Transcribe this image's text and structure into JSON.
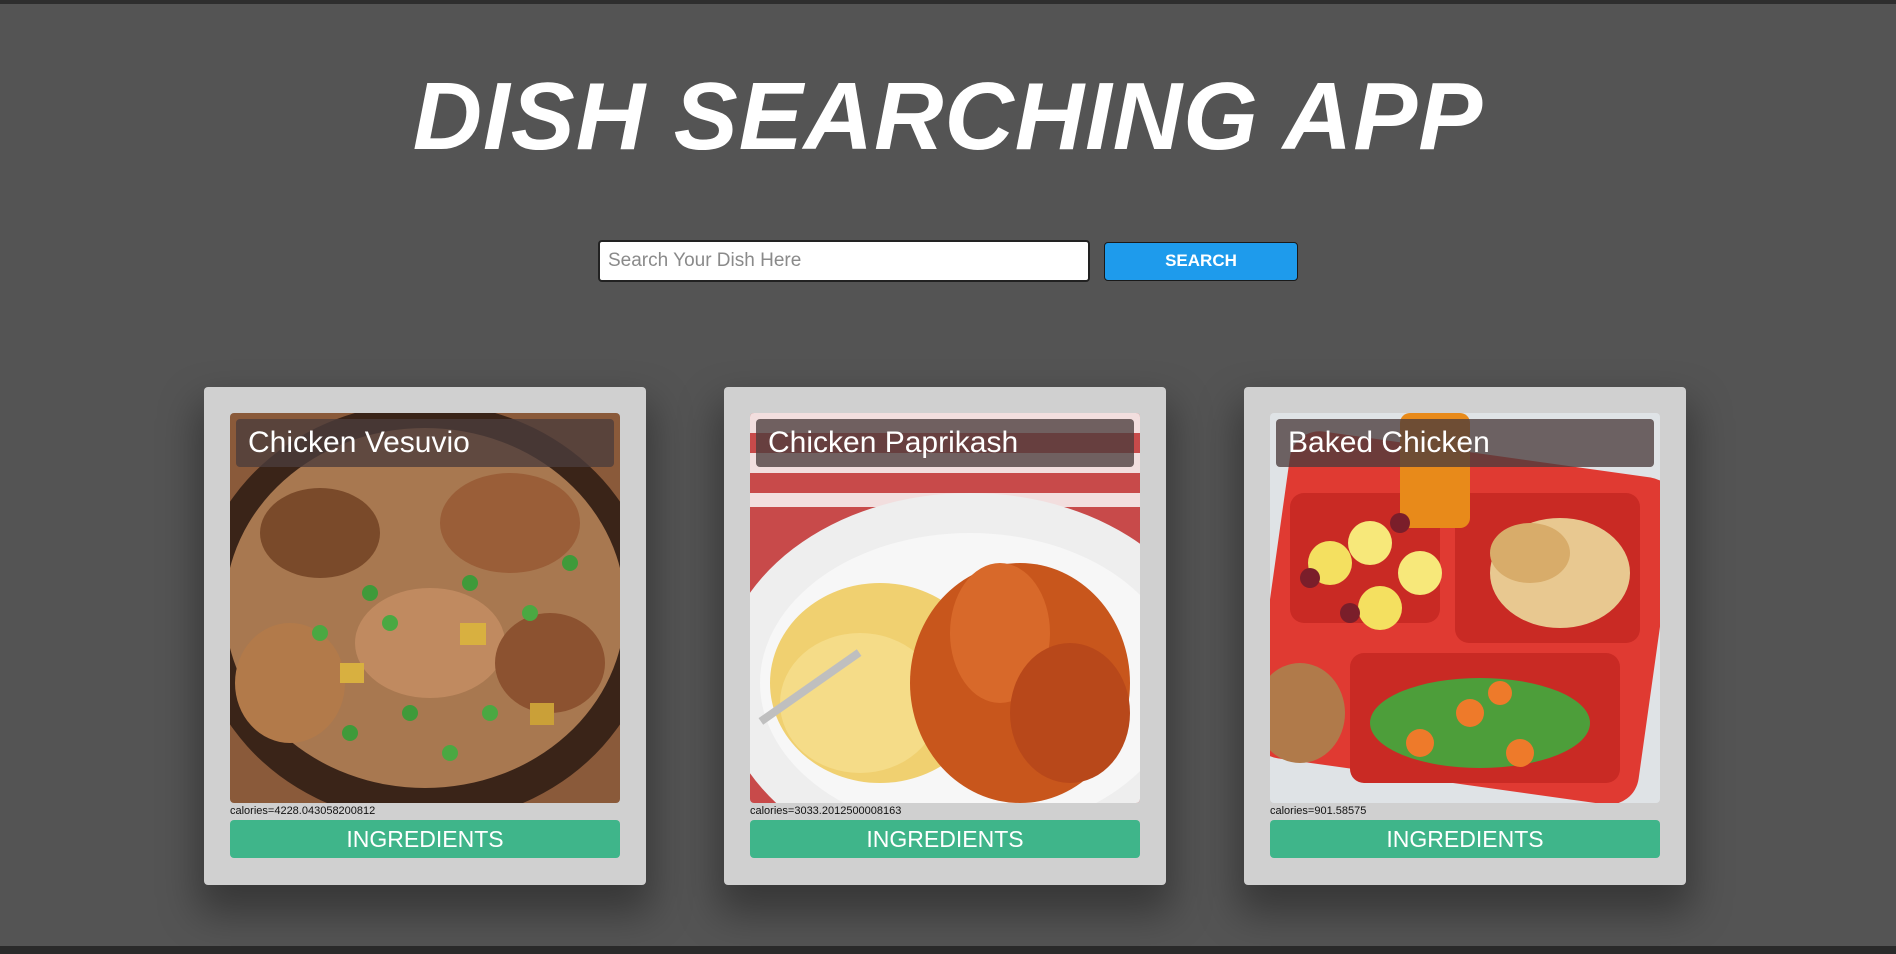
{
  "app": {
    "title": "DISH SEARCHING APP"
  },
  "search": {
    "placeholder": "Search Your Dish Here",
    "value": "",
    "button_label": "SEARCH"
  },
  "dishes": [
    {
      "name": "Chicken Vesuvio",
      "calories": "calories=4228.043058200812",
      "button_label": "INGREDIENTS"
    },
    {
      "name": "Chicken Paprikash",
      "calories": "calories=3033.2012500008163",
      "button_label": "INGREDIENTS"
    },
    {
      "name": "Baked Chicken",
      "calories": "calories=901.58575",
      "button_label": "INGREDIENTS"
    }
  ],
  "colors": {
    "background": "#545454",
    "search_button": "#1e9bec",
    "ingredients_button": "#3fb58a",
    "card": "#d0d0d0"
  }
}
